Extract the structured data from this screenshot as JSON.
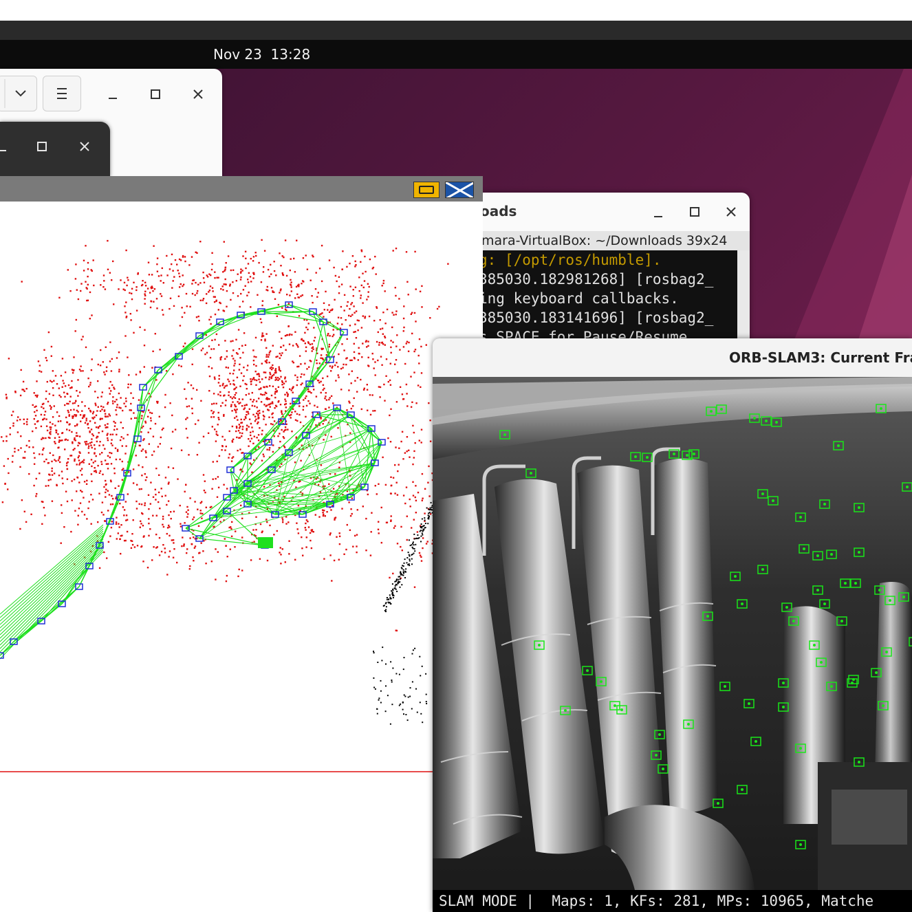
{
  "top_bar": {
    "clock": "Nov 23  13:28"
  },
  "files_window": {
    "view_dropdown_icon": "chevron-down-icon",
    "menu_icon": "hamburger-menu-icon",
    "minimize_icon": "minimize-icon",
    "maximize_icon": "maximize-icon",
    "close_icon": "close-icon"
  },
  "dark_window": {
    "minimize_icon": "minimize-icon",
    "maximize_icon": "maximize-icon",
    "close_icon": "close-icon"
  },
  "map_viewer": {
    "window_button_colors": {
      "minimize": "#f0b400",
      "close": "#1b53a6"
    },
    "point_colors": {
      "map_points": "#e01010",
      "reference_points": "#000000",
      "keyframes": "#1f2fd6",
      "covisibility_graph": "#1fe01f"
    }
  },
  "terminal": {
    "title": "oads",
    "tab_label": "mara-VirtualBox: ~/Downloads 39x24",
    "lines": [
      {
        "text": "g: [/opt/ros/humble].",
        "color": "#c49a00"
      },
      {
        "text": "385030.182981268] [rosbag2_",
        "color": "#e0e0e0"
      },
      {
        "text": "ing keyboard callbacks.",
        "color": "#e0e0e0"
      },
      {
        "text": "385030.183141696] [rosbag2_",
        "color": "#e0e0e0"
      },
      {
        "text": "s SPACE for Pause/Resume",
        "color": "#e0e0e0"
      }
    ]
  },
  "frame_window": {
    "title": "ORB-SLAM3: Current Fra",
    "status": "SLAM MODE |  Maps: 1, KFs: 281, MPs: 10965, Matche",
    "feature_color": "#19e619"
  }
}
